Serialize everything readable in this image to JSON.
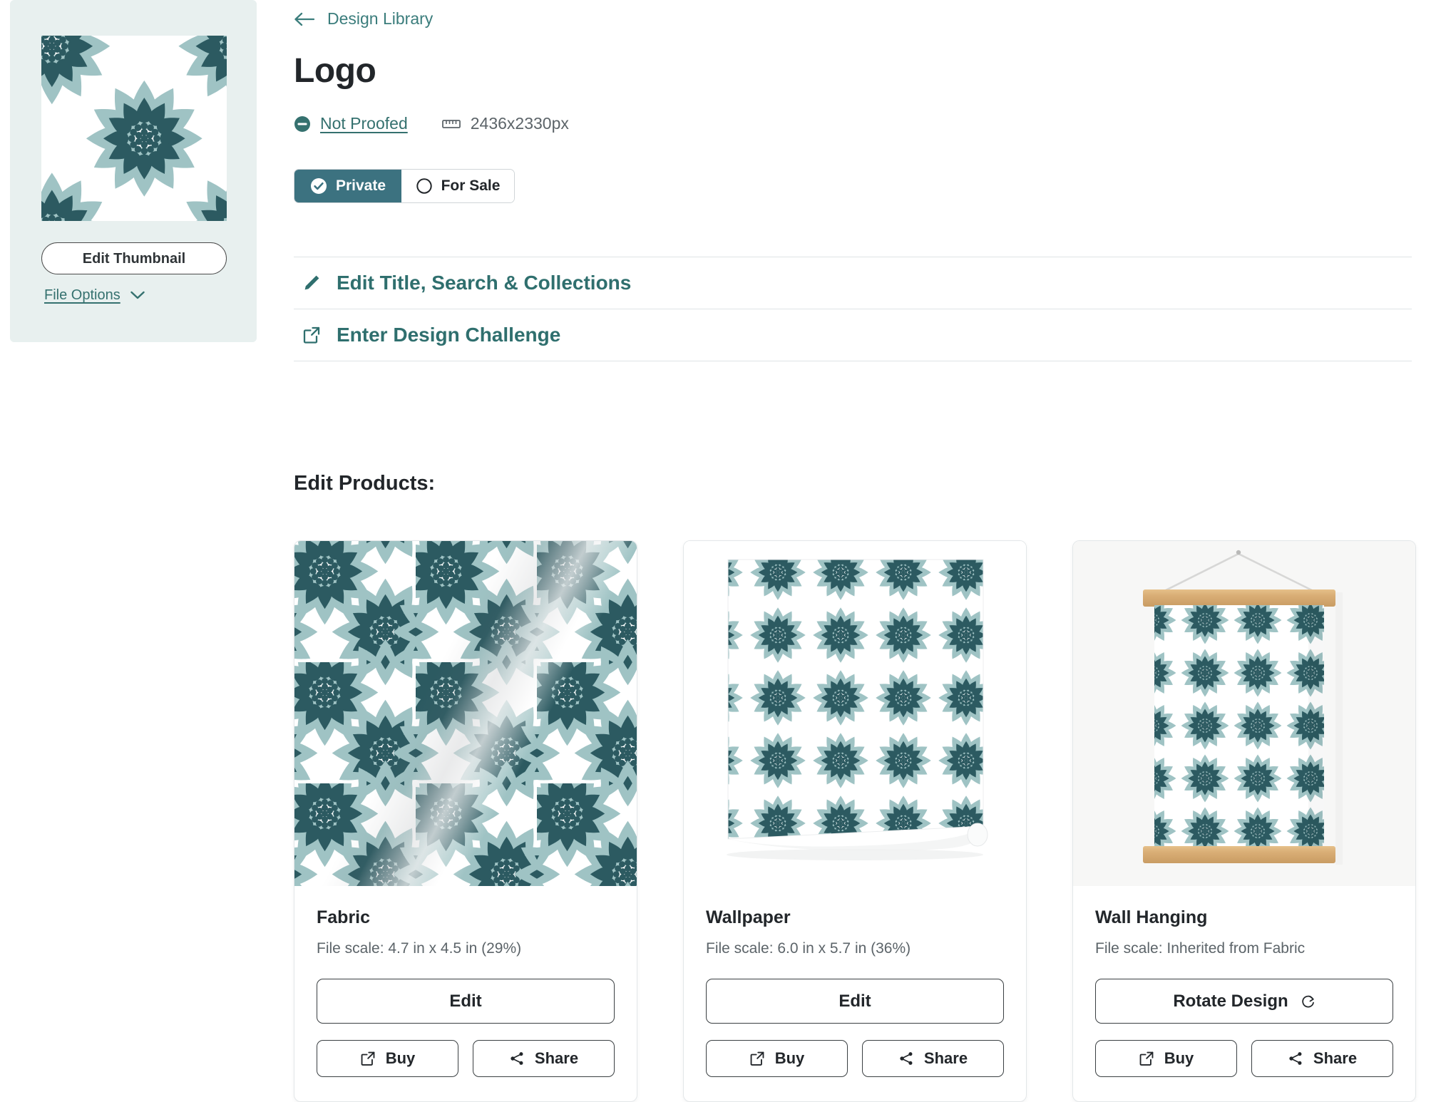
{
  "colors": {
    "teal_link": "#35716f",
    "teal_heading": "#2f6f6e",
    "toggle_active_bg": "#3c7280",
    "panel_bg": "#e8f0ef",
    "text_dark": "#22262a",
    "text_muted": "#5c6469",
    "pattern_light": "#9fc3c4",
    "pattern_dark": "#2c5a61"
  },
  "sidebar": {
    "thumbnail_alt": "flower-pattern-thumbnail",
    "edit_thumbnail_label": "Edit Thumbnail",
    "file_options_label": "File Options",
    "chevron_icon": "chevron-down-icon"
  },
  "header": {
    "back_icon": "arrow-left-icon",
    "breadcrumb_label": "Design Library",
    "title": "Logo",
    "proof_icon": "minus-circle-icon",
    "proof_status": "Not Proofed",
    "ruler_icon": "ruler-icon",
    "dimensions": "2436x2330px"
  },
  "visibility_toggle": {
    "options": [
      {
        "label": "Private",
        "icon": "check-circle-icon",
        "selected": true
      },
      {
        "label": "For Sale",
        "icon": "circle-outline-icon",
        "selected": false
      }
    ]
  },
  "actions": [
    {
      "icon": "pencil-icon",
      "label": "Edit Title, Search & Collections"
    },
    {
      "icon": "external-link-icon",
      "label": "Enter Design Challenge"
    }
  ],
  "products": {
    "heading": "Edit Products:",
    "cards": [
      {
        "title": "Fabric",
        "scale_label": "File scale:",
        "scale_value": "4.7 in x 4.5 in (29%)",
        "primary_label": "Edit",
        "primary_icon": null,
        "buy_label": "Buy",
        "buy_icon": "external-link-icon",
        "share_label": "Share",
        "share_icon": "share-icon",
        "media": "fabric-swatch-image"
      },
      {
        "title": "Wallpaper",
        "scale_label": "File scale:",
        "scale_value": "6.0 in x 5.7 in (36%)",
        "primary_label": "Edit",
        "primary_icon": null,
        "buy_label": "Buy",
        "buy_icon": "external-link-icon",
        "share_label": "Share",
        "share_icon": "share-icon",
        "media": "wallpaper-roll-image"
      },
      {
        "title": "Wall Hanging",
        "scale_label": "File scale:",
        "scale_value": "Inherited from Fabric",
        "primary_label": "Rotate Design",
        "primary_icon": "rotate-icon",
        "buy_label": "Buy",
        "buy_icon": "external-link-icon",
        "share_label": "Share",
        "share_icon": "share-icon",
        "media": "wall-hanging-image"
      }
    ]
  }
}
